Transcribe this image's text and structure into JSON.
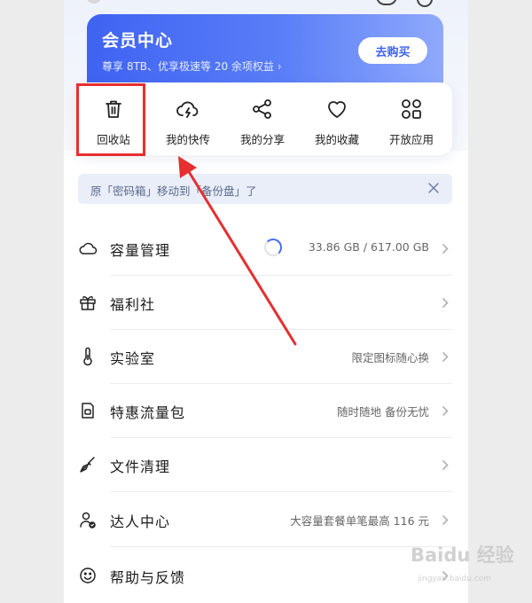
{
  "vip": {
    "title": "会员中心",
    "subtitle": "尊享 8TB、优享极速等 20 余项权益",
    "buy_button": "去购买"
  },
  "quick_actions": [
    {
      "label": "回收站",
      "icon": "trash-icon"
    },
    {
      "label": "我的快传",
      "icon": "cloud-lightning-icon"
    },
    {
      "label": "我的分享",
      "icon": "share-icon"
    },
    {
      "label": "我的收藏",
      "icon": "heart-icon"
    },
    {
      "label": "开放应用",
      "icon": "apps-grid-icon"
    }
  ],
  "notice": {
    "text": "原「密码箱」移动到「备份盘」了"
  },
  "menu": [
    {
      "label": "容量管理",
      "right": "33.86 GB / 617.00 GB",
      "icon": "cloud-icon"
    },
    {
      "label": "福利社",
      "right": "",
      "icon": "gift-icon"
    },
    {
      "label": "实验室",
      "right": "限定图标随心换",
      "icon": "thermometer-icon"
    },
    {
      "label": "特惠流量包",
      "right": "随时随地 备份无忧",
      "icon": "sim-card-icon"
    },
    {
      "label": "文件清理",
      "right": "",
      "icon": "broom-icon"
    },
    {
      "label": "达人中心",
      "right": "大容量套餐单笔最高 116 元",
      "icon": "user-check-icon"
    },
    {
      "label": "帮助与反馈",
      "right": "",
      "icon": "smile-icon"
    }
  ],
  "storage": {
    "used_fraction": 0.055
  },
  "watermark": {
    "main": "Baidu 经验",
    "sub": "jingyan.baidu.com"
  },
  "colors": {
    "accent": "#4a6cf0",
    "annotation": "#e5302f"
  }
}
